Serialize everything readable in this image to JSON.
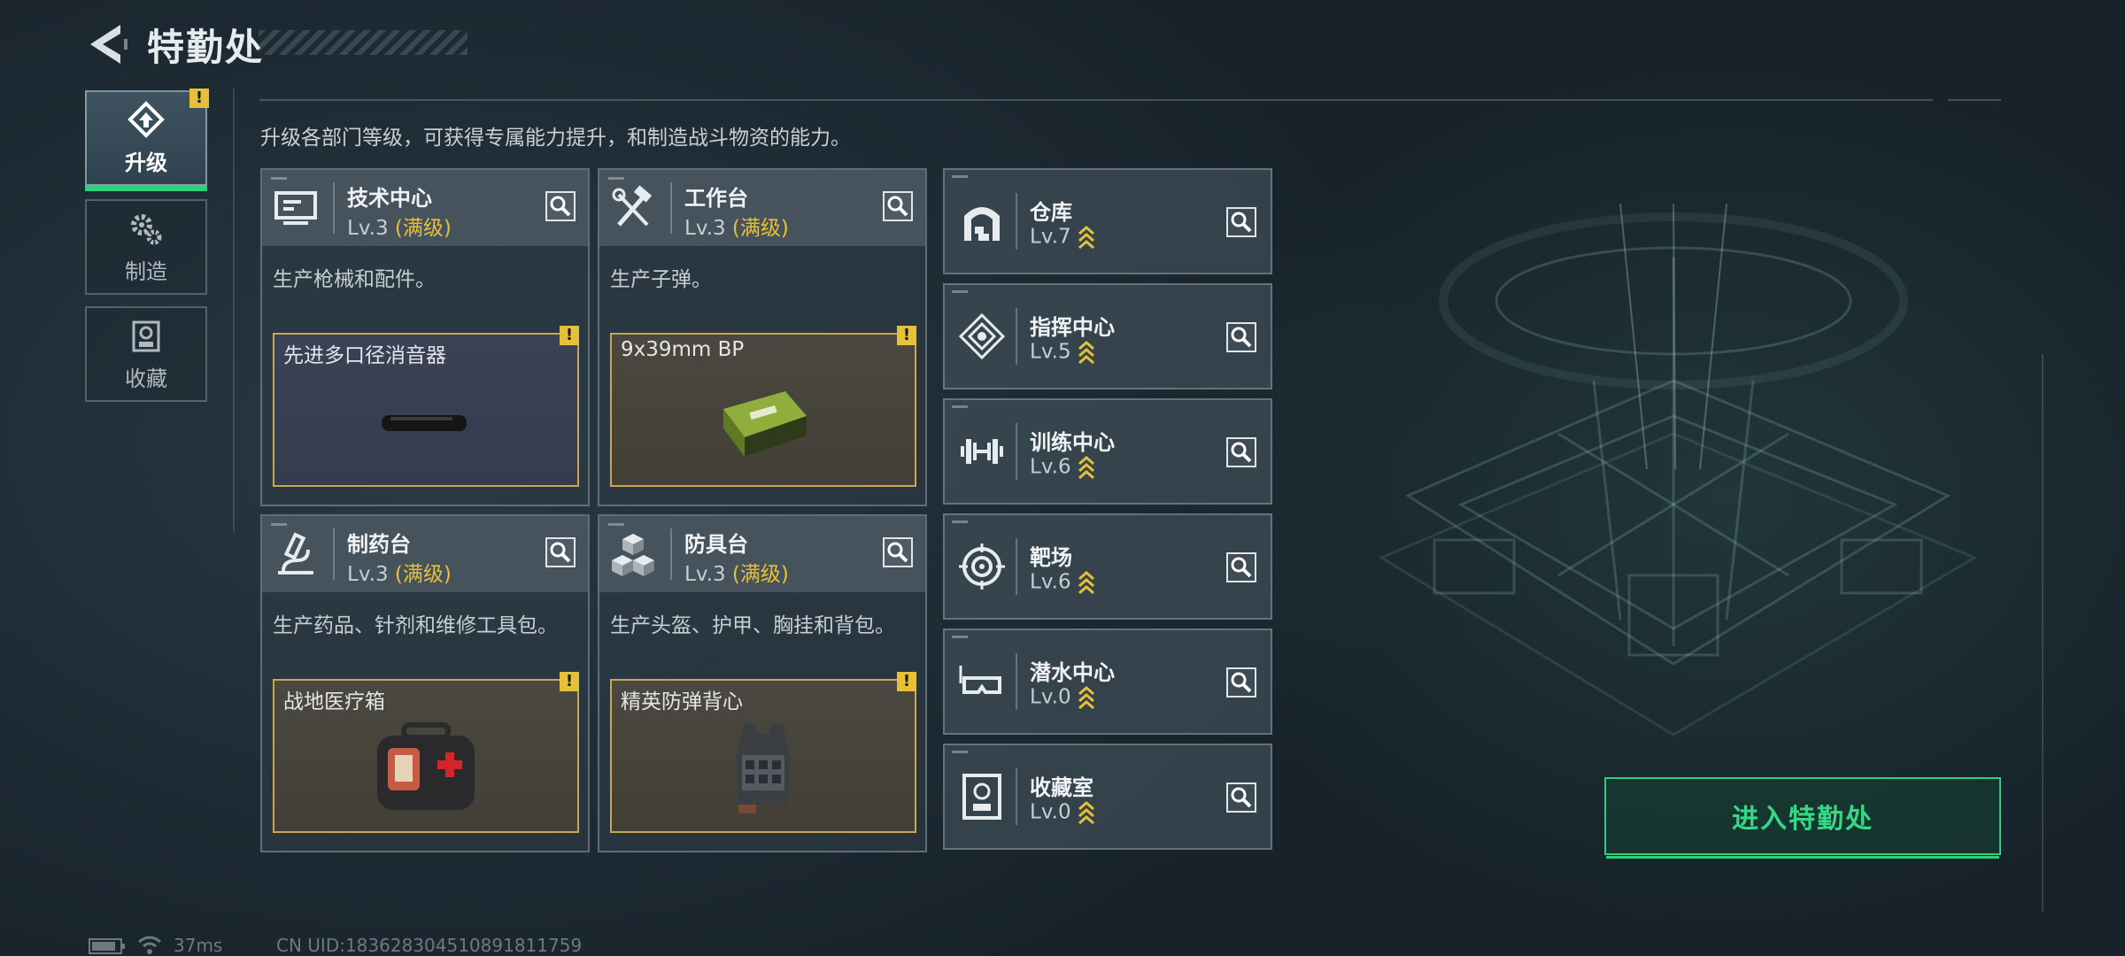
{
  "header": {
    "title": "特勤处"
  },
  "nav": [
    {
      "label": "升级",
      "active": true,
      "alert": "!"
    },
    {
      "label": "制造",
      "active": false
    },
    {
      "label": "收藏",
      "active": false
    }
  ],
  "description": "升级各部门等级，可获得专属能力提升，和制造战斗物资的能力。",
  "cards": [
    {
      "name": "技术中心",
      "level": "Lv.3",
      "maxed": "(满级)",
      "desc": "生产枪械和配件。",
      "product": "先进多口径消音器",
      "alert": "!"
    },
    {
      "name": "工作台",
      "level": "Lv.3",
      "maxed": "(满级)",
      "desc": "生产子弹。",
      "product": "9x39mm BP",
      "alert": "!"
    },
    {
      "name": "制药台",
      "level": "Lv.3",
      "maxed": "(满级)",
      "desc": "生产药品、针剂和维修工具包。",
      "product": "战地医疗箱",
      "alert": "!"
    },
    {
      "name": "防具台",
      "level": "Lv.3",
      "maxed": "(满级)",
      "desc": "生产头盔、护甲、胸挂和背包。",
      "product": "精英防弹背心",
      "alert": "!"
    }
  ],
  "facilities": [
    {
      "name": "仓库",
      "level": "Lv.7"
    },
    {
      "name": "指挥中心",
      "level": "Lv.5"
    },
    {
      "name": "训练中心",
      "level": "Lv.6"
    },
    {
      "name": "靶场",
      "level": "Lv.6"
    },
    {
      "name": "潜水中心",
      "level": "Lv.0"
    },
    {
      "name": "收藏室",
      "level": "Lv.0"
    }
  ],
  "enter_button": "进入特勤处",
  "status": {
    "ping": "37ms",
    "uid": "CN UID:183628304510891811759",
    "battery_level": 0.85
  },
  "colors": {
    "accent_green": "#2ed07e",
    "gold": "#e6c037",
    "panel": "#2d3a44"
  },
  "icons": [
    "back-arrow-icon",
    "upgrade-icon",
    "gears-icon",
    "trophy-icon",
    "monitor-icon",
    "hammer-wrench-icon",
    "microscope-icon",
    "cubes-icon",
    "warehouse-icon",
    "command-emblem-icon",
    "dumbbell-icon",
    "target-icon",
    "diving-mask-icon",
    "collection-icon",
    "search-icon",
    "rank-chevron-icon",
    "wifi-icon",
    "battery-icon"
  ]
}
